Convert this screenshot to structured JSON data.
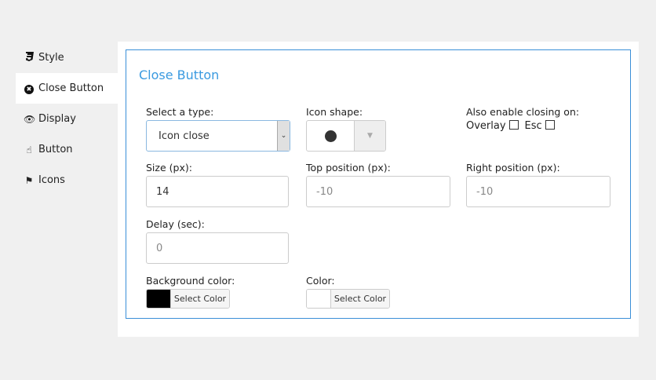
{
  "sidebar": {
    "items": [
      {
        "label": "Style",
        "icon": "css3-icon"
      },
      {
        "label": "Close Button",
        "icon": "times-circle-icon"
      },
      {
        "label": "Display",
        "icon": "eye-icon"
      },
      {
        "label": "Button",
        "icon": "hand-pointer-icon"
      },
      {
        "label": "Icons",
        "icon": "flag-icon"
      }
    ]
  },
  "panel": {
    "title": "Close Button",
    "type_label": "Select a type:",
    "type_value": "Icon close",
    "shape_label": "Icon shape:",
    "closing_label": "Also enable closing on:",
    "overlay_label": "Overlay",
    "esc_label": "Esc",
    "size_label": "Size (px):",
    "size_value": "14",
    "top_label": "Top position (px):",
    "top_value": "-10",
    "right_label": "Right position (px):",
    "right_value": "-10",
    "delay_label": "Delay (sec):",
    "delay_value": "0",
    "bg_label": "Background color:",
    "bg_color": "#000000",
    "bg_button": "Select Color",
    "color_label": "Color:",
    "color_value": "#ffffff",
    "color_button": "Select Color"
  }
}
